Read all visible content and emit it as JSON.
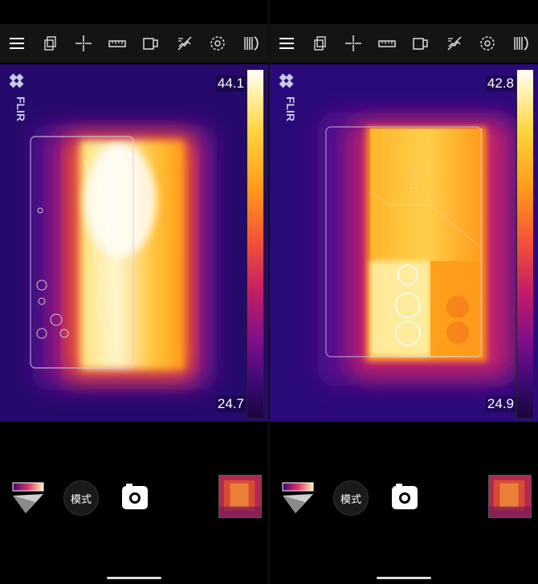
{
  "panels": [
    {
      "id": "left",
      "brand": "FLIR",
      "scale": {
        "max_label": "44.1",
        "min_label": "24.7"
      },
      "mode_label": "模式",
      "toolbar_icons": [
        "menu-icon",
        "overlay-icon",
        "spot-meter-icon",
        "ruler-icon",
        "image-mode-icon",
        "hide-overlay-icon",
        "settings-icon",
        "calibrate-icon"
      ]
    },
    {
      "id": "right",
      "brand": "FLIR",
      "scale": {
        "max_label": "42.8",
        "min_label": "24.9"
      },
      "mode_label": "模式",
      "toolbar_icons": [
        "menu-icon",
        "overlay-icon",
        "spot-meter-icon",
        "ruler-icon",
        "image-mode-icon",
        "hide-overlay-icon",
        "settings-icon",
        "calibrate-icon"
      ]
    }
  ],
  "colors": {
    "background": "#000000",
    "toolbar": "#141414",
    "thermal_cold": "#2a0a78",
    "thermal_hot": "#ffffff",
    "thermal_mid": "#ff9a1a"
  }
}
